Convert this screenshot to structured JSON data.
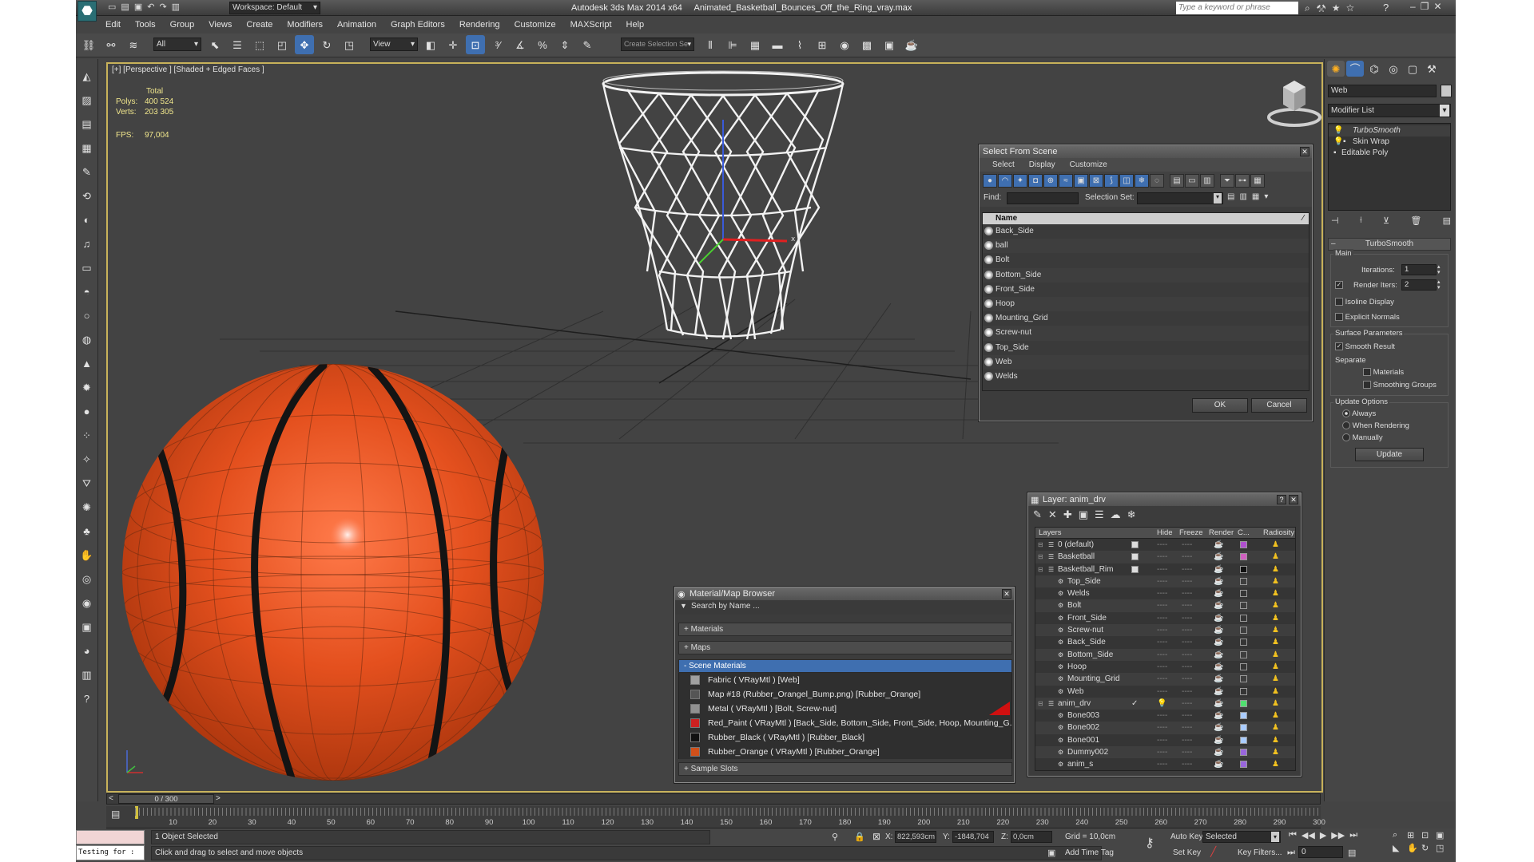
{
  "app": {
    "title": "Autodesk 3ds Max 2014 x64     Animated_Basketball_Bounces_Off_the_Ring_vray.max",
    "workspace": "Workspace: Default",
    "search_placeholder": "Type a keyword or phrase"
  },
  "menu": [
    "Edit",
    "Tools",
    "Group",
    "Views",
    "Create",
    "Modifiers",
    "Animation",
    "Graph Editors",
    "Rendering",
    "Customize",
    "MAXScript",
    "Help"
  ],
  "toolbar": {
    "filter": "All",
    "refcoord": "View",
    "selset": "Create Selection Se"
  },
  "viewport": {
    "label": "[+] [Perspective ] [Shaded + Edged Faces ]",
    "stats": {
      "total": "Total",
      "polys_label": "Polys:",
      "polys": "400 524",
      "verts_label": "Verts:",
      "verts": "203 305",
      "fps_label": "FPS:",
      "fps": "97,004"
    }
  },
  "cmd": {
    "tabs_icons": [
      "sun-icon",
      "bend-icon",
      "hierarchy-icon",
      "motion-icon",
      "display-icon",
      "utilities-icon"
    ],
    "obj_name": "Web",
    "modlist": "Modifier List",
    "stack": [
      "TurboSmooth",
      "Skin Wrap",
      "Editable Poly"
    ],
    "ts": {
      "title": "TurboSmooth",
      "main": "Main",
      "iter_label": "Iterations:",
      "iter": "1",
      "render_label": "Render Iters:",
      "render": "2",
      "isoline": "Isoline Display",
      "explicit": "Explicit Normals",
      "surface": "Surface Parameters",
      "smooth": "Smooth Result",
      "separate": "Separate",
      "materials": "Materials",
      "smoothing": "Smoothing Groups",
      "update_opts": "Update Options",
      "always": "Always",
      "when_rendering": "When Rendering",
      "manually": "Manually",
      "update": "Update"
    }
  },
  "sfs": {
    "title": "Select From Scene",
    "menu": [
      "Select",
      "Display",
      "Customize"
    ],
    "find": "Find:",
    "selset": "Selection Set:",
    "col": "Name",
    "items": [
      "Back_Side",
      "ball",
      "Bolt",
      "Bottom_Side",
      "Front_Side",
      "Hoop",
      "Mounting_Grid",
      "Screw-nut",
      "Top_Side",
      "Web",
      "Welds"
    ],
    "ok": "OK",
    "cancel": "Cancel"
  },
  "layer": {
    "title": "Layer: anim_drv",
    "cols": [
      "Layers",
      "Hide",
      "Freeze",
      "Render",
      "C...",
      "Radiosity"
    ],
    "rows": [
      {
        "name": "0 (default)",
        "indent": 1,
        "color": "#b04fd0"
      },
      {
        "name": "Basketball",
        "indent": 1,
        "color": "#d060c0"
      },
      {
        "name": "Basketball_Rim",
        "indent": 1,
        "color": "#111111"
      },
      {
        "name": "Top_Side",
        "indent": 2,
        "color": ""
      },
      {
        "name": "Welds",
        "indent": 2,
        "color": ""
      },
      {
        "name": "Bolt",
        "indent": 2,
        "color": ""
      },
      {
        "name": "Front_Side",
        "indent": 2,
        "color": ""
      },
      {
        "name": "Screw-nut",
        "indent": 2,
        "color": ""
      },
      {
        "name": "Back_Side",
        "indent": 2,
        "color": ""
      },
      {
        "name": "Bottom_Side",
        "indent": 2,
        "color": ""
      },
      {
        "name": "Hoop",
        "indent": 2,
        "color": ""
      },
      {
        "name": "Mounting_Grid",
        "indent": 2,
        "color": ""
      },
      {
        "name": "Web",
        "indent": 2,
        "color": ""
      },
      {
        "name": "anim_drv",
        "indent": 1,
        "color": "#50e070"
      },
      {
        "name": "Bone003",
        "indent": 2,
        "color": "#aaccff"
      },
      {
        "name": "Bone002",
        "indent": 2,
        "color": "#aaccff"
      },
      {
        "name": "Bone001",
        "indent": 2,
        "color": "#aaccff"
      },
      {
        "name": "Dummy002",
        "indent": 2,
        "color": "#9966dd"
      },
      {
        "name": "anim_s",
        "indent": 2,
        "color": "#9966dd"
      }
    ]
  },
  "mat": {
    "title": "Material/Map Browser",
    "search": "Search by Name ...",
    "materials": "+ Materials",
    "maps": "+ Maps",
    "scene": "- Scene Materials",
    "items": [
      "Fabric  ( VRayMtl ) [Web]",
      "Map #18 (Rubber_Orangel_Bump.png) [Rubber_Orange]",
      "Metal  ( VRayMtl ) [Bolt, Screw-nut]",
      "Red_Paint  ( VRayMtl ) [Back_Side, Bottom_Side, Front_Side, Hoop, Mounting_G...",
      "Rubber_Black  ( VRayMtl ) [Rubber_Black]",
      "Rubber_Orange  ( VRayMtl ) [Rubber_Orange]"
    ],
    "sample": "+ Sample Slots"
  },
  "timeline": {
    "frame": "0 / 300",
    "ticks": [
      "10",
      "20",
      "30",
      "40",
      "50",
      "60",
      "70",
      "80",
      "90",
      "100",
      "110",
      "120",
      "130",
      "140",
      "150",
      "160",
      "170",
      "180",
      "190",
      "200",
      "210",
      "220",
      "230",
      "240",
      "250",
      "260",
      "270",
      "280",
      "290",
      "300"
    ]
  },
  "status": {
    "listener": "Testing for :",
    "selected": "1 Object Selected",
    "hint": "Click and drag to select and move objects",
    "x": "822,593cm",
    "y": "-1848,704",
    "z": "0,0cm",
    "grid": "Grid = 10,0cm",
    "autokey": "Auto Key",
    "setkey": "Set Key",
    "keymode": "Selected",
    "keyfilters": "Key Filters...",
    "addtag": "Add Time Tag",
    "curframe": "0"
  }
}
